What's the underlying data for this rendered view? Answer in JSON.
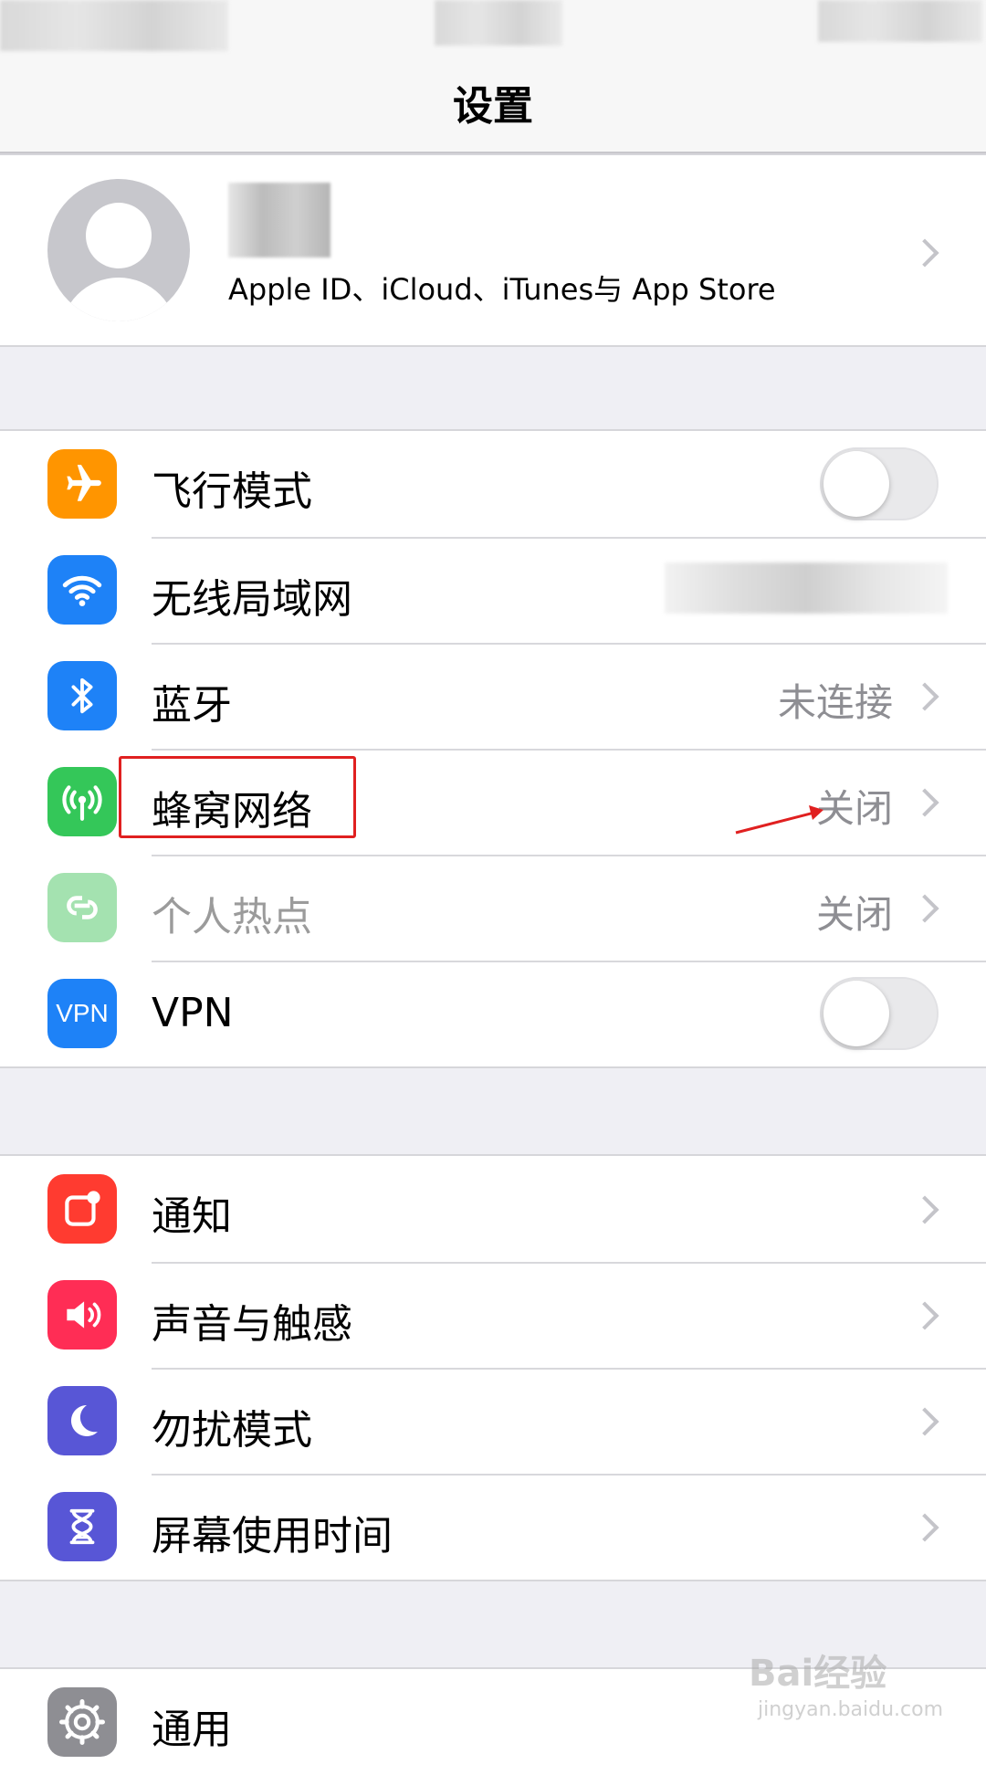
{
  "nav": {
    "title": "设置"
  },
  "profile": {
    "subtitle": "Apple ID、iCloud、iTunes与 App Store"
  },
  "group_network": [
    {
      "key": "airplane",
      "label": "飞行模式",
      "icon": "airplane-icon",
      "color": "#ff9500",
      "control": "toggle",
      "toggle_on": false
    },
    {
      "key": "wifi",
      "label": "无线局域网",
      "icon": "wifi-icon",
      "color": "#1e82f7",
      "control": "blurred-value"
    },
    {
      "key": "bluetooth",
      "label": "蓝牙",
      "value": "未连接",
      "icon": "bluetooth-icon",
      "color": "#1e82f7",
      "control": "chevron"
    },
    {
      "key": "cellular",
      "label": "蜂窝网络",
      "value": "关闭",
      "icon": "antenna-icon",
      "color": "#34c759",
      "control": "chevron"
    },
    {
      "key": "hotspot",
      "label": "个人热点",
      "value": "关闭",
      "icon": "hotspot-icon",
      "color": "#a4e2b0",
      "control": "chevron",
      "dimmed": true
    },
    {
      "key": "vpn",
      "label": "VPN",
      "icon": "vpn-icon",
      "icon_text": "VPN",
      "color": "#1e82f7",
      "control": "toggle",
      "toggle_on": false
    }
  ],
  "group_system": [
    {
      "key": "notifications",
      "label": "通知",
      "icon": "notification-icon",
      "color": "#ff3b30"
    },
    {
      "key": "sounds",
      "label": "声音与触感",
      "icon": "speaker-icon",
      "color": "#ff2d55"
    },
    {
      "key": "dnd",
      "label": "勿扰模式",
      "icon": "moon-icon",
      "color": "#5856d6"
    },
    {
      "key": "screentime",
      "label": "屏幕使用时间",
      "icon": "hourglass-icon",
      "color": "#5856d6"
    }
  ],
  "group_general": [
    {
      "key": "general",
      "label": "通用",
      "icon": "gear-icon",
      "color": "#8e8e93"
    }
  ],
  "watermark": {
    "brand": "Bai经验",
    "url": "jingyan.baidu.com"
  },
  "colors": {
    "highlight": "#e02020",
    "separator": "#d8d8dc",
    "background": "#efeff4"
  }
}
